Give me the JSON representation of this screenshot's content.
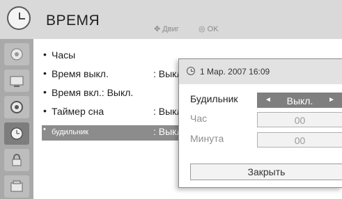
{
  "header": {
    "title": "ВРЕМЯ",
    "hint_move": "Двиг",
    "hint_ok": "OK",
    "move_icon": "dpad-arrows-icon",
    "ok_icon": "ok-circle-icon"
  },
  "sidebar": {
    "items": [
      {
        "icon": "picture-icon"
      },
      {
        "icon": "screen-icon"
      },
      {
        "icon": "audio-icon"
      },
      {
        "icon": "clock-icon",
        "active": true
      },
      {
        "icon": "lock-icon"
      },
      {
        "icon": "options-icon"
      }
    ]
  },
  "menu": {
    "items": [
      {
        "label": "Часы",
        "value": ""
      },
      {
        "label": "Время выкл.",
        "value": ": Выкл."
      },
      {
        "label": "Время вкл.: Выкл.",
        "value": ""
      },
      {
        "label": "Таймер сна",
        "value": ": Выкл."
      },
      {
        "label": "будильник",
        "value": ": Выкл.",
        "selected": true
      }
    ]
  },
  "popup": {
    "datetime": "1 Мар. 2007 16:09",
    "fields": [
      {
        "label": "Будильник",
        "value": "Выкл.",
        "active": true
      },
      {
        "label": "Час",
        "value": "00"
      },
      {
        "label": "Минута",
        "value": "00"
      }
    ],
    "close_label": "Закрыть"
  },
  "colors": {
    "header_bg": "#d9d9d9",
    "sidebar_bg": "#a9a9a9",
    "selected_bg": "#8c8c8c",
    "active_field_bg": "#7f7f7f"
  }
}
